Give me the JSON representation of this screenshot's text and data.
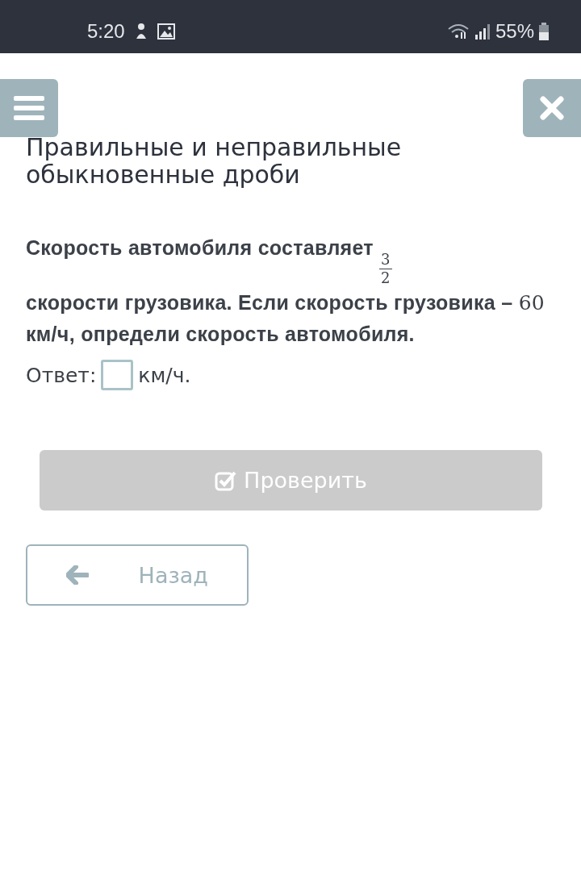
{
  "status_bar": {
    "time": "5:20",
    "battery": "55%"
  },
  "title": "Правильные и неправильные обыкновенные дроби",
  "question": {
    "before": "Скорость автомобиля составляет",
    "numerator": "3",
    "denominator": "2",
    "middle": "скорости грузовика. Если скорость грузовика –",
    "number": "60",
    "after": "км/ч, определи скорость автомобиля."
  },
  "answer": {
    "label": "Ответ:",
    "unit": "км/ч."
  },
  "check_button": {
    "label": "Проверить",
    "disabled": true
  },
  "back_button": {
    "label": "Назад"
  }
}
